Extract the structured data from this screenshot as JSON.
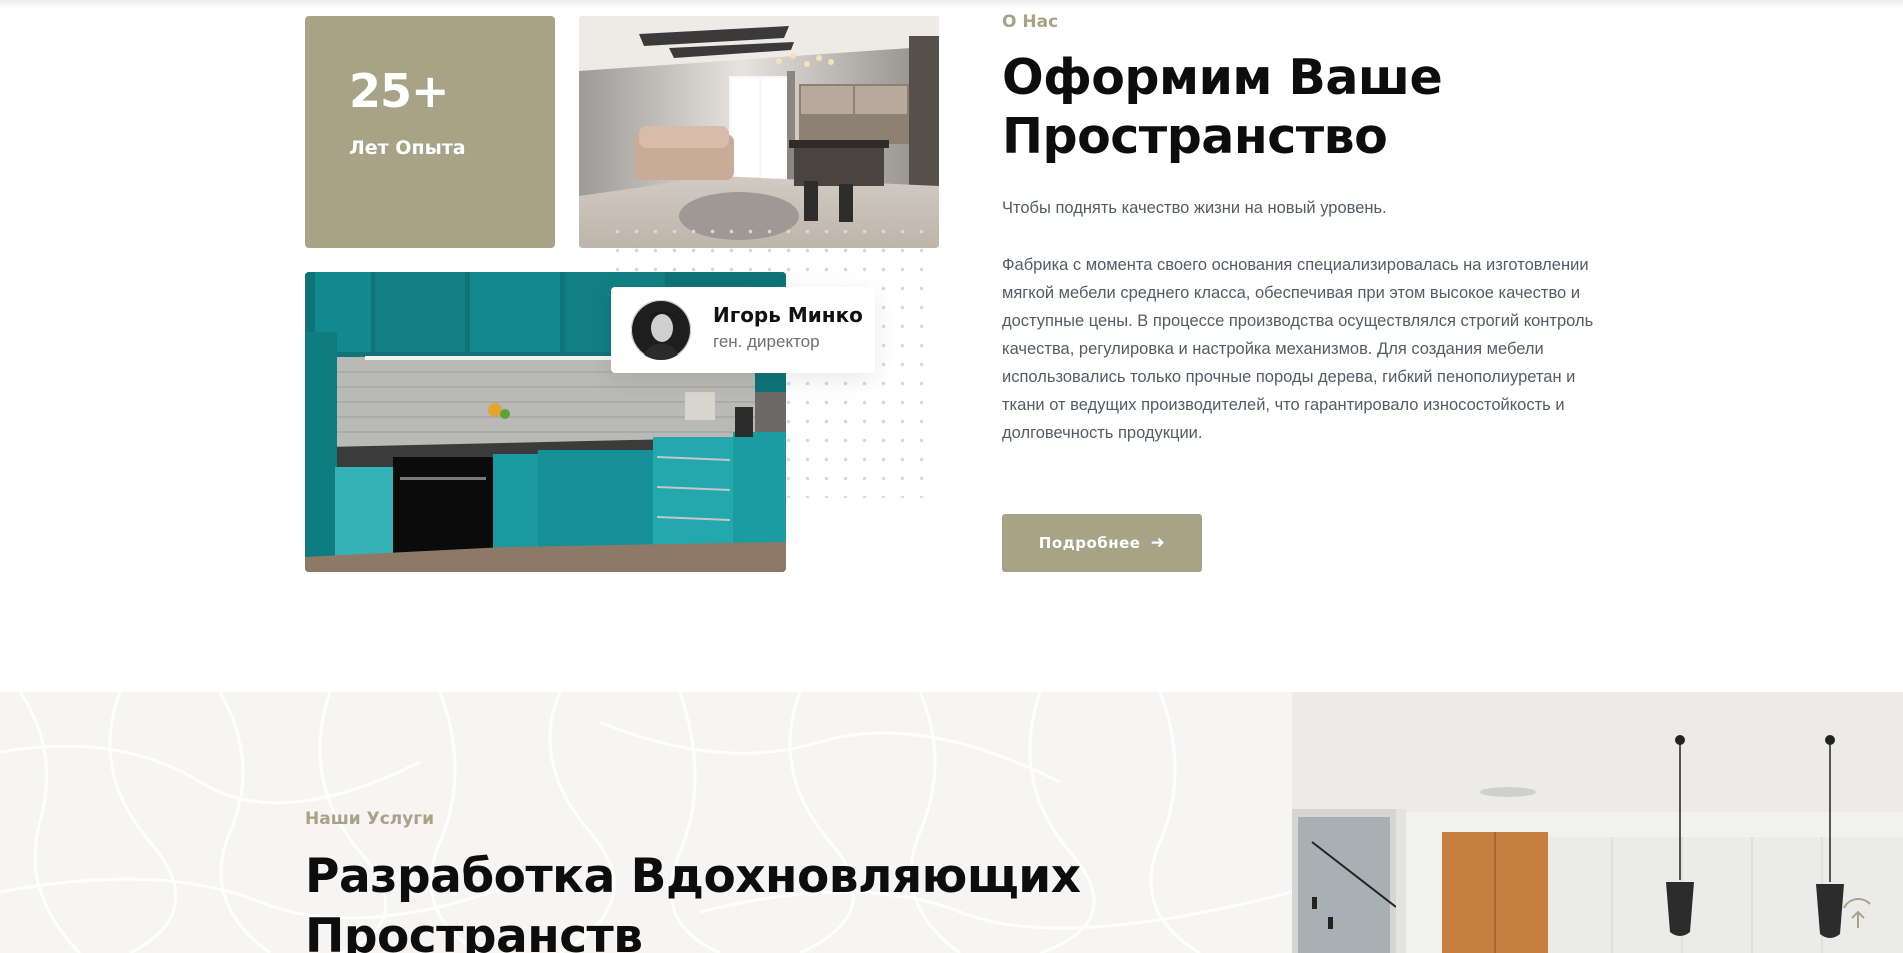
{
  "about": {
    "experience": {
      "number": "25+",
      "label": "Лет Опыта"
    },
    "person": {
      "name": "Игорь Минко",
      "role": "ген. директор"
    },
    "subtitle": "О Нас",
    "title": "Оформим Ваше Пространство",
    "lead": "Чтобы поднять качество жизни на новый уровень.",
    "text": "Фабрика с момента своего основания специализировалась на изготовлении мягкой мебели среднего класса, обеспечивая при этом высокое качество и доступные цены. В процессе производства осуществлялся строгий контроль качества, регулировка и настройка механизмов. Для создания мебели использовались только прочные породы дерева, гибкий пенополиуретан и ткани от ведущих производителей, что гарантировало износостойкость и долговечность продукции.",
    "button_label": "Подробнее",
    "button_icon": "arrow-right-icon"
  },
  "services": {
    "subtitle": "Наши Услуги",
    "title": "Разработка Вдохновляющих Пространств"
  },
  "colors": {
    "accent": "#a8a286",
    "heading": "#0d0d0d",
    "body_text": "#555b66",
    "section_bg": "#f6f5f4"
  }
}
